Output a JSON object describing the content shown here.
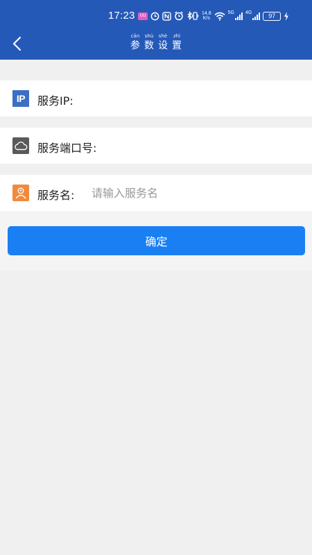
{
  "status_bar": {
    "time": "17:23",
    "badge_text": "UU",
    "net_speed_value": "14.8",
    "net_speed_unit": "K/s",
    "net1_label": "5G",
    "net2_label": "4G",
    "battery": "97"
  },
  "nav": {
    "title_chars": [
      {
        "pinyin": "cān",
        "char": "参"
      },
      {
        "pinyin": "shù",
        "char": "数"
      },
      {
        "pinyin": "shè",
        "char": "设"
      },
      {
        "pinyin": "zhì",
        "char": "置"
      }
    ]
  },
  "form": {
    "ip": {
      "label": "服务IP:",
      "value": "",
      "placeholder": "",
      "icon": "ip-icon",
      "icon_text": "IP"
    },
    "port": {
      "label": "服务端口号:",
      "value": "",
      "placeholder": "",
      "icon": "cloud-icon"
    },
    "name": {
      "label": "服务名:",
      "value": "",
      "placeholder": "请输入服务名",
      "icon": "user-icon"
    }
  },
  "confirm_label": "确定",
  "colors": {
    "header_bg": "#2459b8",
    "button_bg": "#1a7ff2",
    "page_bg": "#f0f0f0",
    "ip_icon_bg": "#3a6fc4",
    "cloud_icon_bg": "#5a5a5a",
    "user_icon_bg": "#f08a3e"
  }
}
